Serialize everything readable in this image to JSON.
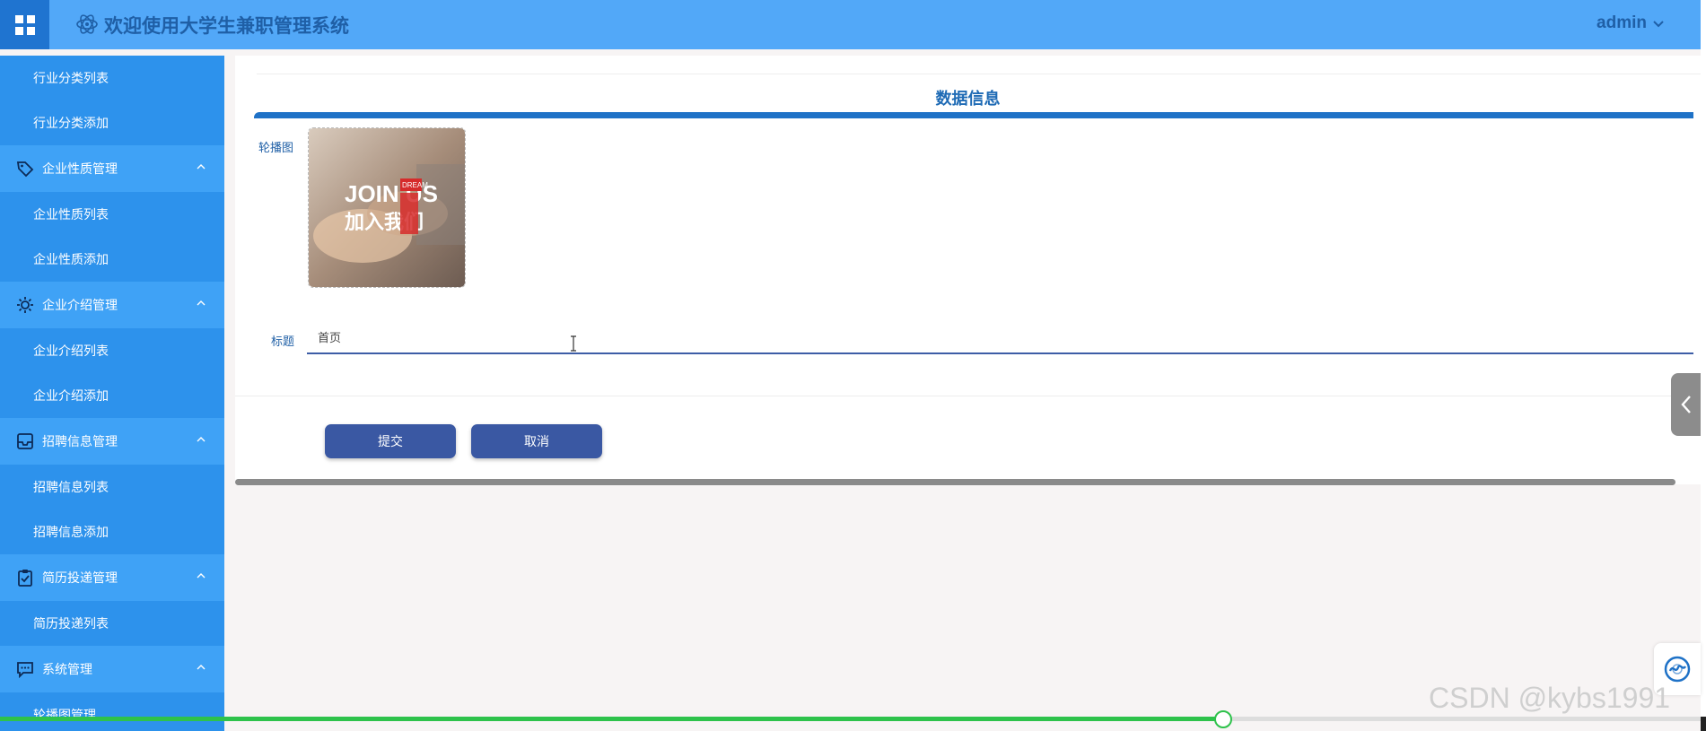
{
  "app": {
    "title": "欢迎使用大学生兼职管理系统",
    "user": "admin"
  },
  "sidebar": {
    "top_items": [
      {
        "label": "行业分类列表"
      },
      {
        "label": "行业分类添加"
      }
    ],
    "groups": [
      {
        "label": "企业性质管理",
        "icon": "tag-icon",
        "items": [
          {
            "label": "企业性质列表"
          },
          {
            "label": "企业性质添加"
          }
        ]
      },
      {
        "label": "企业介绍管理",
        "icon": "gear-icon",
        "items": [
          {
            "label": "企业介绍列表"
          },
          {
            "label": "企业介绍添加"
          }
        ]
      },
      {
        "label": "招聘信息管理",
        "icon": "inbox-icon",
        "items": [
          {
            "label": "招聘信息列表"
          },
          {
            "label": "招聘信息添加"
          }
        ]
      },
      {
        "label": "简历投递管理",
        "icon": "clipboard-check-icon",
        "items": [
          {
            "label": "简历投递列表"
          }
        ]
      },
      {
        "label": "系统管理",
        "icon": "message-icon",
        "items": [
          {
            "label": "轮播图管理"
          }
        ]
      }
    ]
  },
  "form": {
    "section_title": "数据信息",
    "banner_label": "轮播图",
    "banner_image": {
      "text_main": "JOIN US",
      "text_sub": "加入我们",
      "badge": "DREAM"
    },
    "title_label": "标题",
    "title_value": "首页",
    "submit_label": "提交",
    "cancel_label": "取消"
  },
  "watermark": "CSDN @kybs1991",
  "video_progress": 0.718,
  "colors": {
    "topbar": "#52a8f8",
    "sidebar": "#2d92ec",
    "accent": "#1f72c7",
    "button": "#3a58a3"
  }
}
